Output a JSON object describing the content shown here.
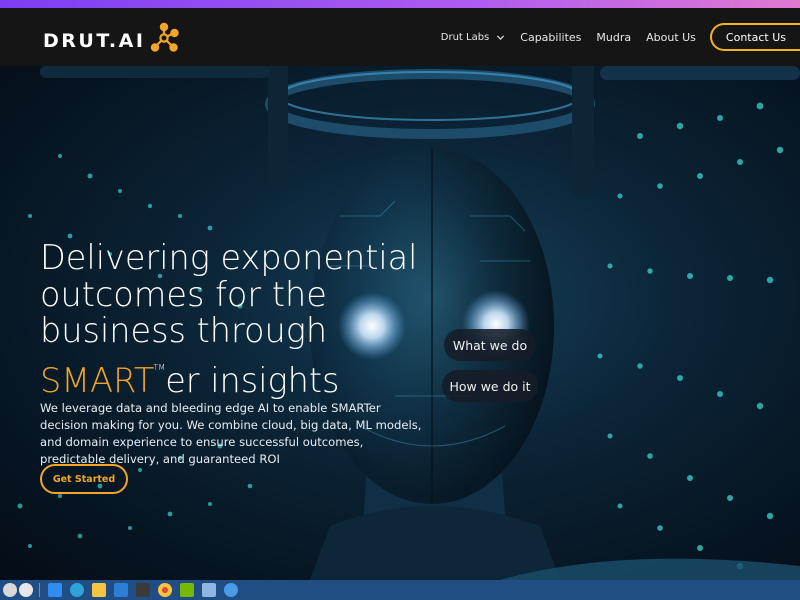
{
  "brand": {
    "name": "DRUT.AI",
    "accent_color": "#f3a626",
    "purple_strip": "#8a48f0"
  },
  "nav": {
    "items": [
      {
        "label": "Drut Labs",
        "has_dropdown": true
      },
      {
        "label": "Capabilites",
        "has_dropdown": false
      },
      {
        "label": "Mudra",
        "has_dropdown": false
      },
      {
        "label": "About Us",
        "has_dropdown": false
      }
    ],
    "contact_label": "Contact Us"
  },
  "hero": {
    "headline_line1": "Delivering exponential",
    "headline_line2": "outcomes for the",
    "headline_line3": "business through",
    "headline_accent": "SMART",
    "headline_tm": "TM",
    "headline_suffix": "er insights",
    "subtext": "We leverage data and bleeding edge AI to enable SMARTer decision making for you. We combine cloud, big data, ML models, and domain experience to ensure successful outcomes, predictable delivery, and guaranteed ROI",
    "cta_label": "Get Started"
  },
  "pills": {
    "what_label": "What we do",
    "how_label": "How we do it"
  },
  "taskbar": {
    "icons": [
      "search-icon",
      "chat-icon",
      "windows-icon",
      "edge-icon",
      "folder-icon",
      "vscode-icon",
      "terminal-icon",
      "chrome-icon",
      "nvidia-icon",
      "network-icon",
      "chrome-icon-2"
    ]
  }
}
